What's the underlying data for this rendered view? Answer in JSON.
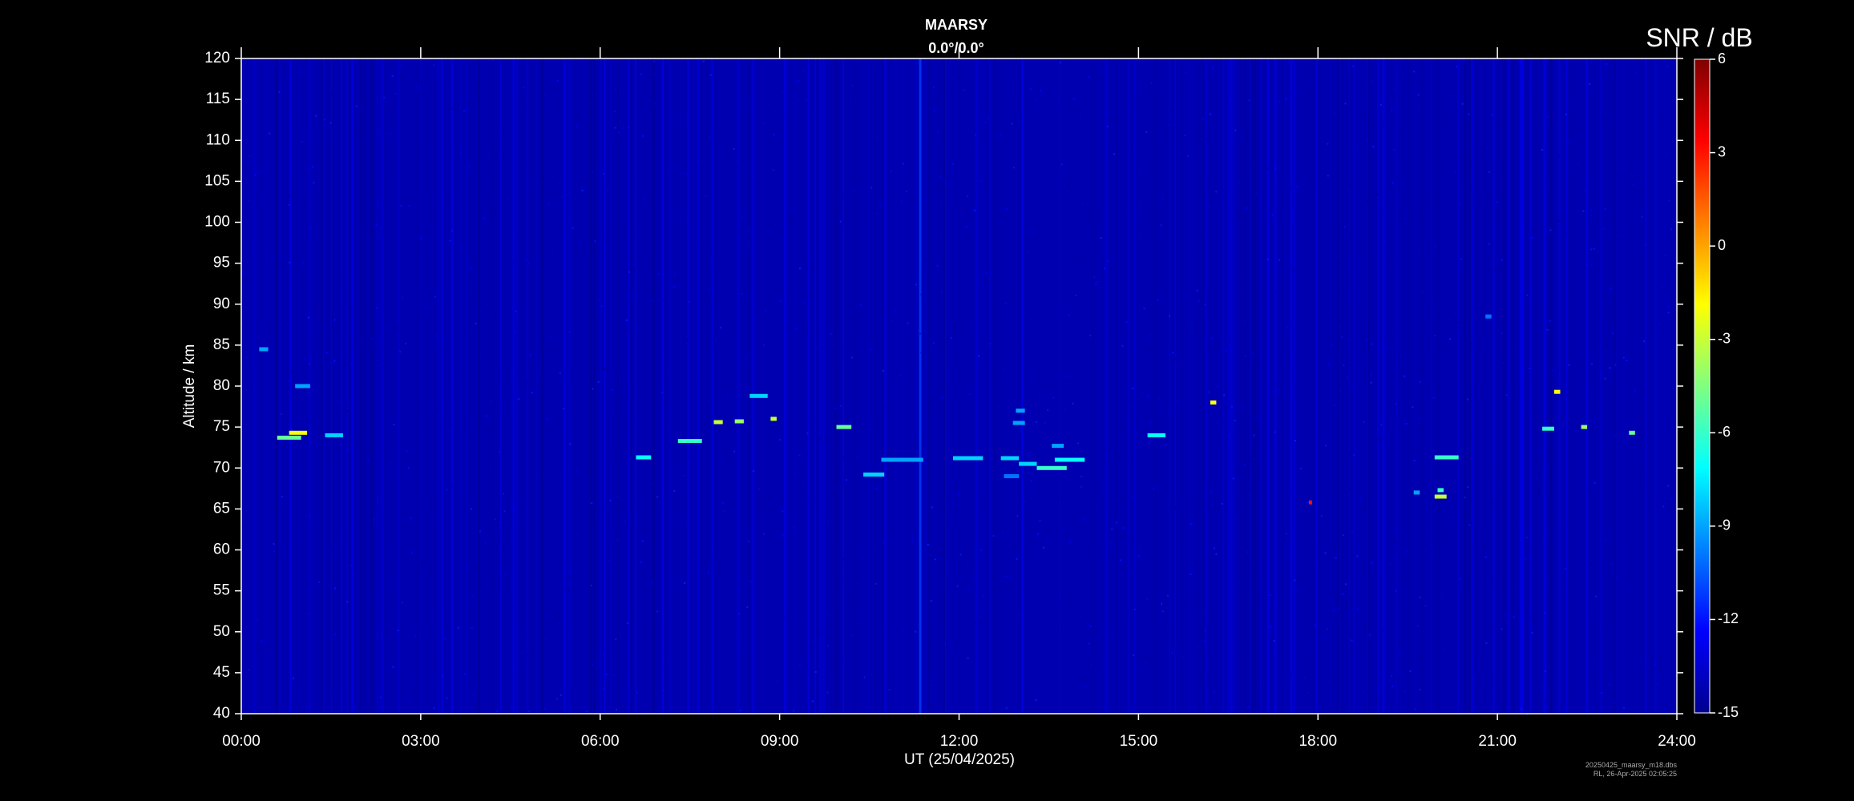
{
  "chart_data": {
    "type": "heatmap",
    "title": "MAARSY",
    "subtitle": "0.0°/0.0°",
    "xlabel": "UT (25/04/2025)",
    "ylabel": "Altitude / km",
    "xlim": [
      0,
      24
    ],
    "ylim": [
      40,
      120
    ],
    "x_tick_labels": [
      "00:00",
      "03:00",
      "06:00",
      "09:00",
      "12:00",
      "15:00",
      "18:00",
      "21:00",
      "24:00"
    ],
    "y_tick_labels": [
      "40",
      "45",
      "50",
      "55",
      "60",
      "65",
      "70",
      "75",
      "80",
      "85",
      "90",
      "95",
      "100",
      "105",
      "110",
      "115",
      "120"
    ],
    "colorbar": {
      "title": "SNR / dB",
      "range": [
        -15,
        6
      ],
      "tick_labels": [
        "-15",
        "-12",
        "-9",
        "-6",
        "-3",
        "0",
        "3",
        "6"
      ],
      "colormap": "jet"
    },
    "background_snr_db": -14,
    "grid": false,
    "echoes": [
      {
        "t_start": 0.3,
        "t_end": 0.45,
        "alt": 84.5,
        "snr": -9
      },
      {
        "t_start": 0.6,
        "t_end": 1.0,
        "alt": 73.7,
        "snr": -5
      },
      {
        "t_start": 0.8,
        "t_end": 1.1,
        "alt": 74.3,
        "snr": -2
      },
      {
        "t_start": 1.4,
        "t_end": 1.7,
        "alt": 74.0,
        "snr": -8
      },
      {
        "t_start": 0.9,
        "t_end": 1.15,
        "alt": 80.0,
        "snr": -9
      },
      {
        "t_start": 6.6,
        "t_end": 6.85,
        "alt": 71.3,
        "snr": -7
      },
      {
        "t_start": 7.3,
        "t_end": 7.7,
        "alt": 73.3,
        "snr": -6
      },
      {
        "t_start": 7.9,
        "t_end": 8.05,
        "alt": 75.6,
        "snr": -3
      },
      {
        "t_start": 8.25,
        "t_end": 8.4,
        "alt": 75.7,
        "snr": -4
      },
      {
        "t_start": 8.5,
        "t_end": 8.8,
        "alt": 78.8,
        "snr": -8
      },
      {
        "t_start": 8.85,
        "t_end": 8.95,
        "alt": 76.0,
        "snr": -3
      },
      {
        "t_start": 9.95,
        "t_end": 10.2,
        "alt": 75.0,
        "snr": -5
      },
      {
        "t_start": 10.4,
        "t_end": 10.75,
        "alt": 69.2,
        "snr": -8
      },
      {
        "t_start": 10.7,
        "t_end": 11.4,
        "alt": 71.0,
        "snr": -9
      },
      {
        "t_start": 11.9,
        "t_end": 12.4,
        "alt": 71.2,
        "snr": -8
      },
      {
        "t_start": 12.7,
        "t_end": 13.0,
        "alt": 71.2,
        "snr": -8
      },
      {
        "t_start": 12.75,
        "t_end": 13.0,
        "alt": 69.0,
        "snr": -10
      },
      {
        "t_start": 12.9,
        "t_end": 13.1,
        "alt": 75.5,
        "snr": -9
      },
      {
        "t_start": 12.95,
        "t_end": 13.1,
        "alt": 77.0,
        "snr": -9
      },
      {
        "t_start": 13.0,
        "t_end": 13.3,
        "alt": 70.5,
        "snr": -8
      },
      {
        "t_start": 13.3,
        "t_end": 13.8,
        "alt": 70.0,
        "snr": -6
      },
      {
        "t_start": 13.6,
        "t_end": 14.1,
        "alt": 71.0,
        "snr": -7
      },
      {
        "t_start": 13.55,
        "t_end": 13.75,
        "alt": 72.7,
        "snr": -9
      },
      {
        "t_start": 15.15,
        "t_end": 15.45,
        "alt": 74.0,
        "snr": -7
      },
      {
        "t_start": 16.2,
        "t_end": 16.3,
        "alt": 78.0,
        "snr": -2
      },
      {
        "t_start": 17.85,
        "t_end": 17.9,
        "alt": 65.8,
        "snr": 3
      },
      {
        "t_start": 19.95,
        "t_end": 20.35,
        "alt": 71.3,
        "snr": -6
      },
      {
        "t_start": 19.95,
        "t_end": 20.15,
        "alt": 66.5,
        "snr": -3
      },
      {
        "t_start": 20.0,
        "t_end": 20.1,
        "alt": 67.3,
        "snr": -6
      },
      {
        "t_start": 19.6,
        "t_end": 19.7,
        "alt": 67.0,
        "snr": -9
      },
      {
        "t_start": 20.8,
        "t_end": 20.9,
        "alt": 88.5,
        "snr": -10
      },
      {
        "t_start": 21.75,
        "t_end": 21.95,
        "alt": 74.8,
        "snr": -6
      },
      {
        "t_start": 21.95,
        "t_end": 22.05,
        "alt": 79.3,
        "snr": -2
      },
      {
        "t_start": 22.4,
        "t_end": 22.5,
        "alt": 75.0,
        "snr": -4
      },
      {
        "t_start": 23.2,
        "t_end": 23.3,
        "alt": 74.3,
        "snr": -5
      }
    ]
  },
  "footer": {
    "filename": "20250425_maarsy_m18.dbs",
    "timestamp": "RL, 26-Apr-2025 02:05:25"
  }
}
